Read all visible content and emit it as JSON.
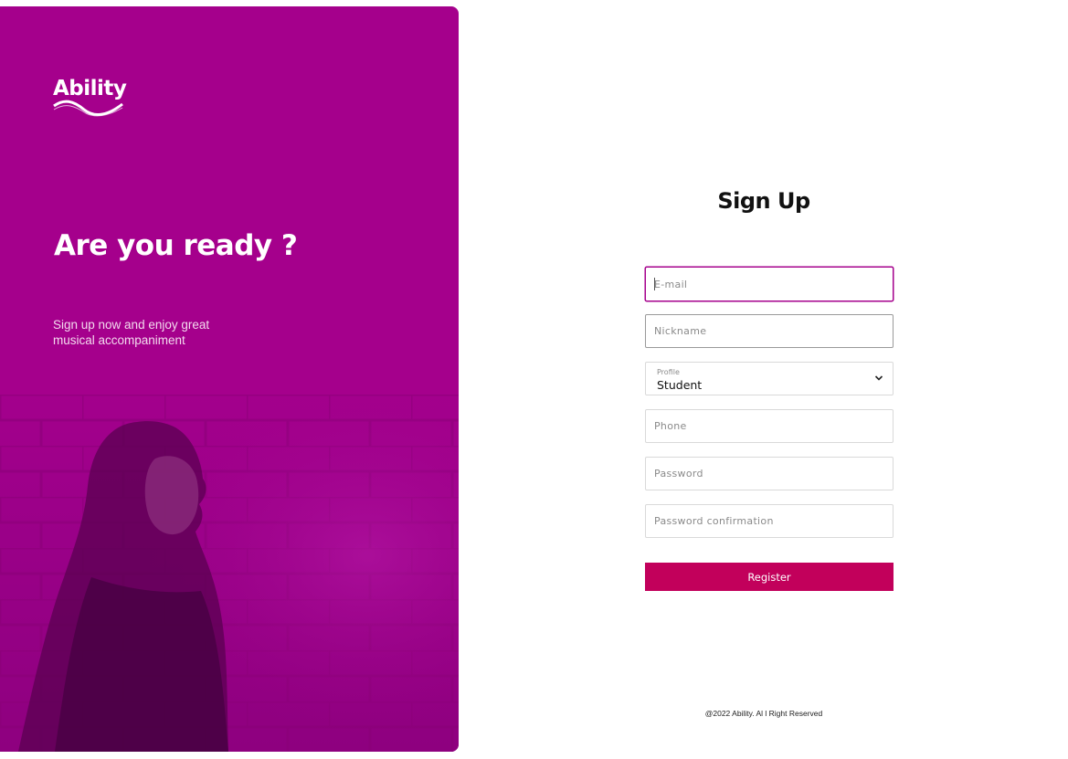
{
  "brand": {
    "logo_text": "Ability"
  },
  "hero": {
    "headline": "Are you ready ?",
    "subtitle_line1": "Sign up now and enjoy great",
    "subtitle_line2": "musical accompaniment"
  },
  "form": {
    "title": "Sign Up",
    "email": {
      "placeholder": "E-mail",
      "value": ""
    },
    "nickname": {
      "placeholder": "Nickname",
      "value": ""
    },
    "profile": {
      "label": "Profile",
      "selected": "Student"
    },
    "phone": {
      "placeholder": "Phone",
      "value": ""
    },
    "password": {
      "placeholder": "Password",
      "value": ""
    },
    "password_confirmation": {
      "placeholder": "Password confirmation",
      "value": ""
    },
    "register_label": "Register"
  },
  "footer": {
    "text": "@2022 Ability. Al l Right Reserved"
  },
  "colors": {
    "panel": "#a5008c",
    "button": "#c2005b",
    "focus_border": "#a5008c"
  },
  "icons": {
    "profile_dropdown": "chevron-down-icon"
  }
}
